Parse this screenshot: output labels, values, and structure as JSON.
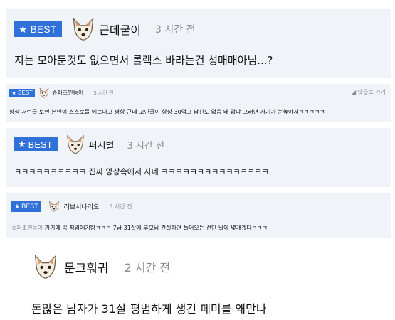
{
  "accent_color": "#3071d9",
  "badge_icon": "star-icon",
  "comments": [
    {
      "badge": "BEST",
      "avatar": "dog-avatar",
      "nickname": "근데굳이",
      "time": "3 시간 전",
      "text": "지는 모아둔것도 없으면서 롤렉스 바라는건 성매매아님...?"
    },
    {
      "badge": "BEST",
      "avatar": "dog-avatar",
      "nickname": "슈퍼초찐동이",
      "time": "3 시간 전",
      "reply_label": "댓글로 가기",
      "text": "항상 저런글 보면 본인이 스스로를 에르다고 평함 근데 고민글이 항상 30억고 남친도 없음 왜 없냐 그러면 자기가 눈높아서ㅋㅋㅋㅋㅋ"
    },
    {
      "badge": "BEST",
      "avatar": "dog-avatar",
      "nickname": "퍼시벌",
      "time": "3 시간 전",
      "text": "ㅋㅋㅋㅋㅋㅋㅋㅋㅋㅋ 진짜 망상속에서 사네 ㅋㅋㅋㅋㅋㅋㅋㅋㅋㅋㅋㅋㅋㅋㅋ"
    },
    {
      "badge": "BEST",
      "avatar": "dog-avatar",
      "nickname": "러브시나리오",
      "time": "3 시간 전",
      "reply_to": "슈퍼초찐동이",
      "text": "거기에 꼭 직업애기함ㅋㅋㅋ 7급 31살에 부모님 건실하면 들어오는 선만 달에 몇개겠다ㅋㅋㅋ"
    },
    {
      "avatar": "dog-avatar",
      "nickname": "문크훠궈",
      "time": "2 시간 전",
      "text": "돈많은 남자가 31살 평범하게 생긴 페미를 왜만나"
    }
  ]
}
